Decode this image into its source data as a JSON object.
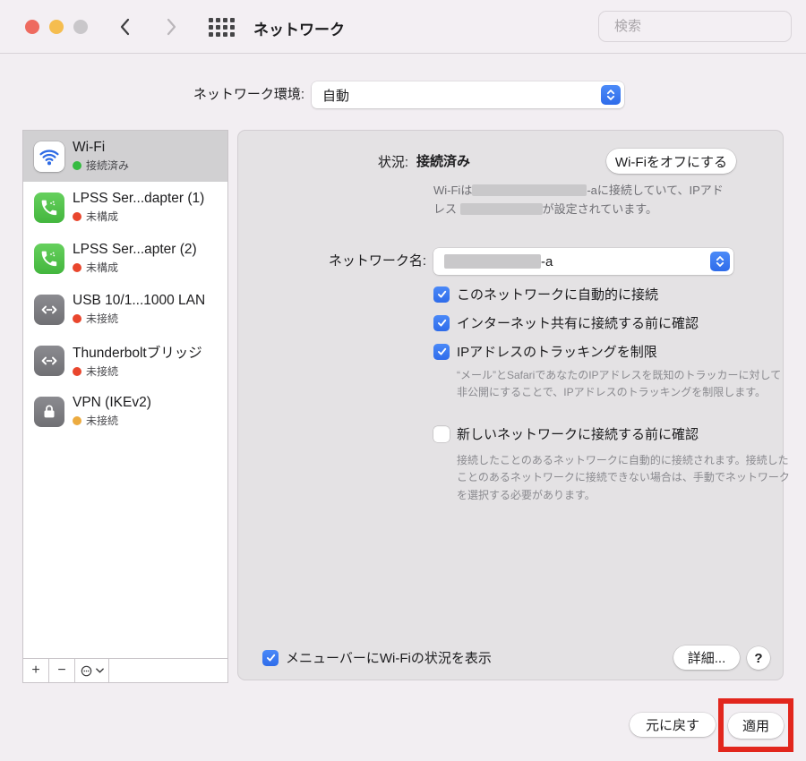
{
  "titlebar": {
    "title": "ネットワーク",
    "search_placeholder": "検索"
  },
  "location": {
    "label": "ネットワーク環境:",
    "value": "自動"
  },
  "sidebar": {
    "items": [
      {
        "name": "Wi-Fi",
        "status": "接続済み",
        "icon": "wifi-icon",
        "dot_color": "green",
        "selected": true
      },
      {
        "name": "LPSS Ser...dapter (1)",
        "status": "未構成",
        "icon": "phone-icon",
        "dot_color": "red",
        "selected": false
      },
      {
        "name": "LPSS Ser...apter (2)",
        "status": "未構成",
        "icon": "phone-icon",
        "dot_color": "red",
        "selected": false
      },
      {
        "name": "USB 10/1...1000 LAN",
        "status": "未接続",
        "icon": "ethernet-icon",
        "dot_color": "red",
        "selected": false
      },
      {
        "name": "Thunderboltブリッジ",
        "status": "未接続",
        "icon": "ethernet-icon",
        "dot_color": "red",
        "selected": false
      },
      {
        "name": "VPN (IKEv2)",
        "status": "未接続",
        "icon": "lock-icon",
        "dot_color": "yellow",
        "selected": false
      }
    ],
    "add_label": "+",
    "remove_label": "−"
  },
  "main": {
    "status_label": "状況:",
    "status_value": "接続済み",
    "turn_off_button": "Wi-Fiをオフにする",
    "desc_part1": "Wi-Fiは",
    "desc_part2": "-aに接続していて、IPアド",
    "desc_part3": "レス",
    "desc_part4": "が設定されています。",
    "network_name_label": "ネットワーク名:",
    "network_name_suffix": "-a",
    "cb_auto_join": "このネットワークに自動的に接続",
    "cb_ask_sharing": "インターネット共有に接続する前に確認",
    "cb_limit_tracking": "IPアドレスのトラッキングを制限",
    "note_tracking": "“メール”とSafariであなたのIPアドレスを既知のトラッカーに対して非公開にすることで、IPアドレスのトラッキングを制限します。",
    "cb_ask_new": "新しいネットワークに接続する前に確認",
    "note_ask_new": "接続したことのあるネットワークに自動的に接続されます。接続したことのあるネットワークに接続できない場合は、手動でネットワークを選択する必要があります。",
    "cb_menubar": "メニューバーにWi-Fiの状況を表示",
    "advanced_button": "詳細...",
    "help_button": "?"
  },
  "footer": {
    "revert_button": "元に戻す",
    "apply_button": "適用"
  },
  "colors": {
    "accent_blue": "#3b79f2",
    "status_green": "#35bb41",
    "status_red": "#e9462d",
    "status_yellow": "#ecab40",
    "annotation_red": "#e2261d",
    "panel_bg": "#e4e2e4",
    "window_bg": "#f2eef2"
  }
}
